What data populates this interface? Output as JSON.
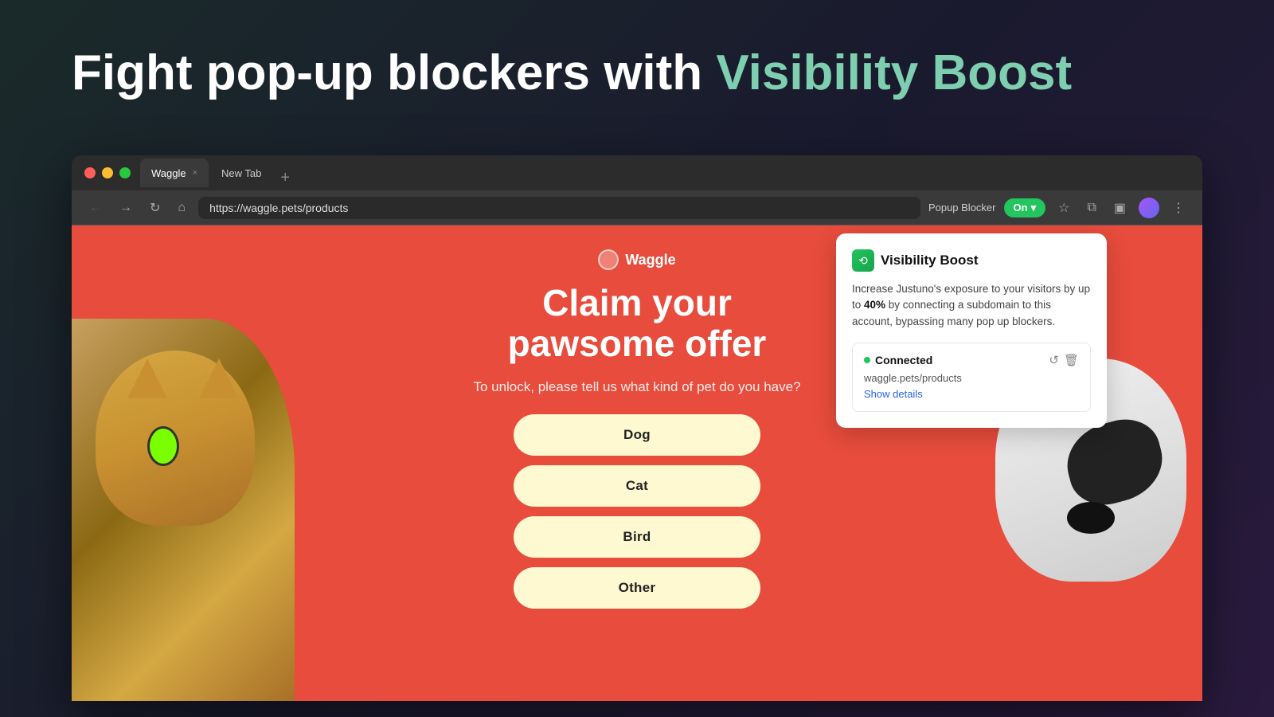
{
  "hero": {
    "title_part1": "Fight pop-up blockers with ",
    "title_highlight": "Visibility Boost"
  },
  "browser": {
    "tabs": [
      {
        "id": "waggle",
        "label": "Waggle",
        "active": true
      },
      {
        "id": "new-tab",
        "label": "New Tab",
        "active": false
      }
    ],
    "url": "https://waggle.pets/products",
    "toolbar": {
      "popup_blocker_label": "Popup Blocker",
      "toggle_label": "On",
      "toggle_arrow": "▾"
    }
  },
  "webpage": {
    "brand": "Waggle",
    "headline_line1": "Claim your",
    "headline_line2": "pawsome offer",
    "subtitle": "To unlock, please tell us what kind of pet do you have?",
    "options": [
      {
        "id": "dog",
        "label": "Dog"
      },
      {
        "id": "cat",
        "label": "Cat"
      },
      {
        "id": "bird",
        "label": "Bird"
      },
      {
        "id": "other",
        "label": "Other"
      }
    ]
  },
  "visibility_popup": {
    "title": "Visibility Boost",
    "description_prefix": "Increase Justuno's exposure to your visitors by up to ",
    "description_percent": "40%",
    "description_suffix": " by connecting a subdomain to this account, bypassing many pop up blockers.",
    "connected_label": "Connected",
    "domain": "waggle.pets/products",
    "show_details_label": "Show details"
  },
  "icons": {
    "back": "←",
    "forward": "→",
    "refresh": "↻",
    "home": "⌂",
    "star": "☆",
    "puzzle": "⧉",
    "sidebar": "▣",
    "menu": "⋮",
    "refresh_small": "↺",
    "delete": "🗑",
    "tab_close": "×",
    "tab_new": "+",
    "logo_symbol": "⟲"
  },
  "colors": {
    "accent_green": "#22c55e",
    "page_red": "#e74c3c",
    "brand_blue": "#2563eb",
    "cream_btn": "#fef9d0"
  }
}
